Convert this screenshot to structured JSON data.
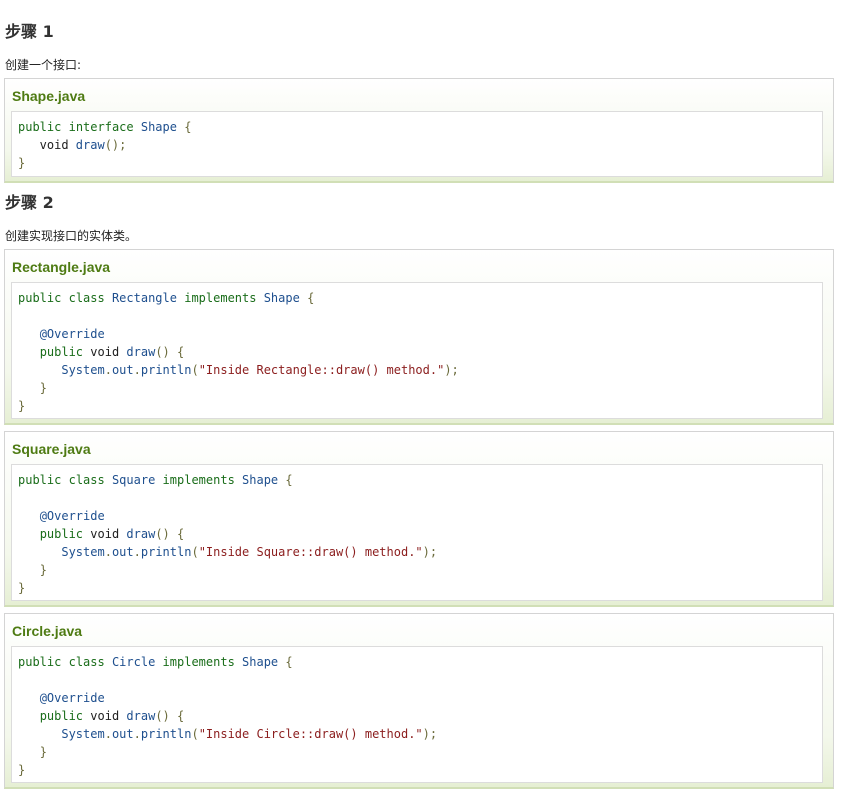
{
  "steps": [
    {
      "heading": "步骤 1",
      "description": "创建一个接口:",
      "files": [
        {
          "filename": "Shape.java",
          "lines": [
            [
              [
                "kw",
                "public"
              ],
              [
                "ty",
                " "
              ],
              [
                "kw",
                "interface"
              ],
              [
                "ty",
                " "
              ],
              [
                "cn",
                "Shape"
              ],
              [
                "ty",
                " "
              ],
              [
                "pn",
                "{"
              ]
            ],
            [
              [
                "ty",
                "   void "
              ],
              [
                "fn",
                "draw"
              ],
              [
                "pn",
                "();"
              ]
            ],
            [
              [
                "pn",
                "}"
              ]
            ]
          ]
        }
      ]
    },
    {
      "heading": "步骤 2",
      "description": "创建实现接口的实体类。",
      "files": [
        {
          "filename": "Rectangle.java",
          "lines": [
            [
              [
                "kw",
                "public"
              ],
              [
                "ty",
                " "
              ],
              [
                "kw",
                "class"
              ],
              [
                "ty",
                " "
              ],
              [
                "cn",
                "Rectangle"
              ],
              [
                "ty",
                " "
              ],
              [
                "kw",
                "implements"
              ],
              [
                "ty",
                " "
              ],
              [
                "cn",
                "Shape"
              ],
              [
                "ty",
                " "
              ],
              [
                "pn",
                "{"
              ]
            ],
            [],
            [
              [
                "ty",
                "   "
              ],
              [
                "an",
                "@Override"
              ]
            ],
            [
              [
                "ty",
                "   "
              ],
              [
                "kw",
                "public"
              ],
              [
                "ty",
                " void "
              ],
              [
                "fn",
                "draw"
              ],
              [
                "pn",
                "() {"
              ]
            ],
            [
              [
                "ty",
                "      "
              ],
              [
                "cn",
                "System"
              ],
              [
                "pn",
                "."
              ],
              [
                "cn",
                "out"
              ],
              [
                "pn",
                "."
              ],
              [
                "fn",
                "println"
              ],
              [
                "pn",
                "("
              ],
              [
                "st",
                "\"Inside Rectangle::draw() method.\""
              ],
              [
                "pn",
                ");"
              ]
            ],
            [
              [
                "ty",
                "   "
              ],
              [
                "pn",
                "}"
              ]
            ],
            [
              [
                "pn",
                "}"
              ]
            ]
          ]
        },
        {
          "filename": "Square.java",
          "lines": [
            [
              [
                "kw",
                "public"
              ],
              [
                "ty",
                " "
              ],
              [
                "kw",
                "class"
              ],
              [
                "ty",
                " "
              ],
              [
                "cn",
                "Square"
              ],
              [
                "ty",
                " "
              ],
              [
                "kw",
                "implements"
              ],
              [
                "ty",
                " "
              ],
              [
                "cn",
                "Shape"
              ],
              [
                "ty",
                " "
              ],
              [
                "pn",
                "{"
              ]
            ],
            [],
            [
              [
                "ty",
                "   "
              ],
              [
                "an",
                "@Override"
              ]
            ],
            [
              [
                "ty",
                "   "
              ],
              [
                "kw",
                "public"
              ],
              [
                "ty",
                " void "
              ],
              [
                "fn",
                "draw"
              ],
              [
                "pn",
                "() {"
              ]
            ],
            [
              [
                "ty",
                "      "
              ],
              [
                "cn",
                "System"
              ],
              [
                "pn",
                "."
              ],
              [
                "cn",
                "out"
              ],
              [
                "pn",
                "."
              ],
              [
                "fn",
                "println"
              ],
              [
                "pn",
                "("
              ],
              [
                "st",
                "\"Inside Square::draw() method.\""
              ],
              [
                "pn",
                ");"
              ]
            ],
            [
              [
                "ty",
                "   "
              ],
              [
                "pn",
                "}"
              ]
            ],
            [
              [
                "pn",
                "}"
              ]
            ]
          ]
        },
        {
          "filename": "Circle.java",
          "lines": [
            [
              [
                "kw",
                "public"
              ],
              [
                "ty",
                " "
              ],
              [
                "kw",
                "class"
              ],
              [
                "ty",
                " "
              ],
              [
                "cn",
                "Circle"
              ],
              [
                "ty",
                " "
              ],
              [
                "kw",
                "implements"
              ],
              [
                "ty",
                " "
              ],
              [
                "cn",
                "Shape"
              ],
              [
                "ty",
                " "
              ],
              [
                "pn",
                "{"
              ]
            ],
            [],
            [
              [
                "ty",
                "   "
              ],
              [
                "an",
                "@Override"
              ]
            ],
            [
              [
                "ty",
                "   "
              ],
              [
                "kw",
                "public"
              ],
              [
                "ty",
                " void "
              ],
              [
                "fn",
                "draw"
              ],
              [
                "pn",
                "() {"
              ]
            ],
            [
              [
                "ty",
                "      "
              ],
              [
                "cn",
                "System"
              ],
              [
                "pn",
                "."
              ],
              [
                "cn",
                "out"
              ],
              [
                "pn",
                "."
              ],
              [
                "fn",
                "println"
              ],
              [
                "pn",
                "("
              ],
              [
                "st",
                "\"Inside Circle::draw() method.\""
              ],
              [
                "pn",
                ");"
              ]
            ],
            [
              [
                "ty",
                "   "
              ],
              [
                "pn",
                "}"
              ]
            ],
            [
              [
                "pn",
                "}"
              ]
            ]
          ]
        }
      ]
    }
  ]
}
